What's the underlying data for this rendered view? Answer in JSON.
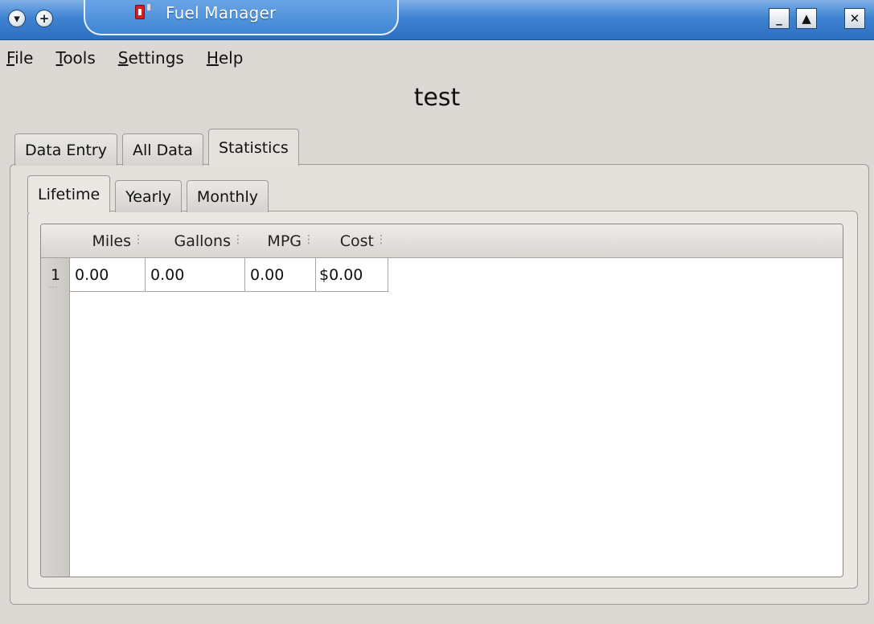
{
  "window": {
    "title": "Fuel Manager",
    "icons": {
      "menu": "chevron-down-icon",
      "add": "plus-icon",
      "app": "fuel-pump-icon",
      "minimize": "minimize-icon",
      "maximize": "maximize-icon",
      "close": "close-icon"
    },
    "title_bar_color": "#3f84d2"
  },
  "menubar": {
    "items": [
      {
        "first": "F",
        "rest": "ile"
      },
      {
        "first": "T",
        "rest": "ools"
      },
      {
        "first": "S",
        "rest": "ettings"
      },
      {
        "first": "H",
        "rest": "elp"
      }
    ]
  },
  "heading": "test",
  "tabs": [
    {
      "label": "Data Entry",
      "active": false
    },
    {
      "label": "All Data",
      "active": false
    },
    {
      "label": "Statistics",
      "active": true
    }
  ],
  "subtabs": [
    {
      "label": "Lifetime",
      "active": true
    },
    {
      "label": "Yearly",
      "active": false
    },
    {
      "label": "Monthly",
      "active": false
    }
  ],
  "table": {
    "columns": [
      "Miles",
      "Gallons",
      "MPG",
      "Cost"
    ],
    "rows": [
      {
        "num": "1",
        "cells": [
          "0.00",
          "0.00",
          "0.00",
          "$0.00"
        ]
      }
    ]
  }
}
